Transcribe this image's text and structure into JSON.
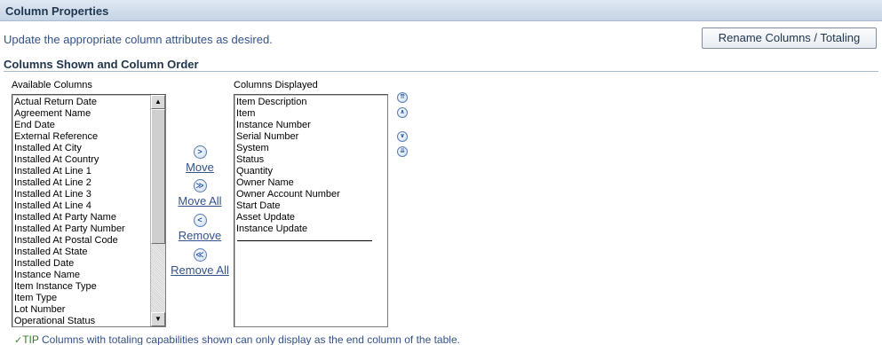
{
  "section": {
    "title": "Column Properties"
  },
  "instruction": "Update the appropriate column attributes as desired.",
  "rename_button": {
    "label": "Rename Columns / Totaling"
  },
  "subsection": {
    "title": "Columns Shown and Column Order"
  },
  "available": {
    "label": "Available Columns",
    "items": [
      "Actual Return Date",
      "Agreement Name",
      "End Date",
      "External Reference",
      "Installed At City",
      "Installed At Country",
      "Installed At Line 1",
      "Installed At Line 2",
      "Installed At Line 3",
      "Installed At Line 4",
      "Installed At Party Name",
      "Installed At Party Number",
      "Installed At Postal Code",
      "Installed At State",
      "Installed Date",
      "Instance Name",
      "Item Instance Type",
      "Item Type",
      "Lot Number",
      "Operational Status"
    ]
  },
  "displayed": {
    "label": "Columns Displayed",
    "items": [
      "Item Description",
      "Item",
      "Instance Number",
      "Serial Number",
      "System",
      "Status",
      "Quantity",
      "Owner Name",
      "Owner Account Number",
      "Start Date",
      "Asset Update",
      "Instance Update"
    ]
  },
  "shuttle": {
    "move": {
      "label": "Move",
      "glyph": ">"
    },
    "move_all": {
      "label": "Move All",
      "glyph": "≫"
    },
    "remove": {
      "label": "Remove",
      "glyph": "<"
    },
    "remove_all": {
      "label": "Remove All",
      "glyph": "≪"
    }
  },
  "order_icons": {
    "top": "move-to-top-icon",
    "up": "move-up-icon",
    "down": "move-down-icon",
    "bottom": "move-to-bottom-icon"
  },
  "tip": {
    "label": "TIP",
    "text": "Columns with totaling capabilities shown can only display as the end column of the table."
  },
  "colors": {
    "link": "#33528a",
    "header_text": "#21374f",
    "header_bg": "#c5d4e6"
  }
}
